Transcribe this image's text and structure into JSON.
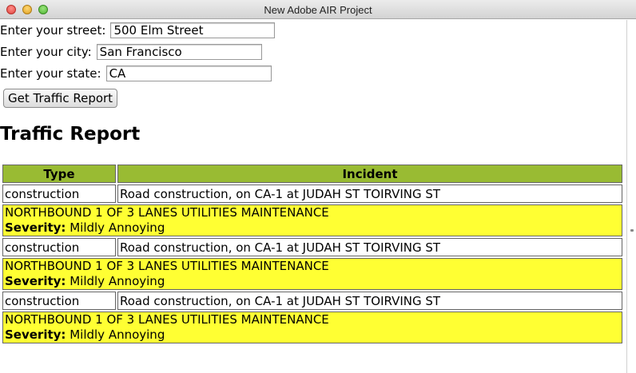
{
  "window": {
    "title": "New Adobe AIR Project"
  },
  "form": {
    "street_label": "Enter your street:",
    "street_value": "500 Elm Street",
    "city_label": "Enter your city:",
    "city_value": "San Francisco",
    "state_label": "Enter your state:",
    "state_value": "CA",
    "submit_label": "Get Traffic Report"
  },
  "report": {
    "heading": "Traffic Report",
    "columns": [
      "Type",
      "Incident"
    ],
    "severity_label": "Severity:",
    "incidents": [
      {
        "type": "construction",
        "incident": "Road construction, on CA-1 at JUDAH ST TOIRVING ST",
        "description": "NORTHBOUND 1 OF 3 LANES UTILITIES MAINTENANCE",
        "severity": "Mildly Annoying"
      },
      {
        "type": "construction",
        "incident": "Road construction, on CA-1 at JUDAH ST TOIRVING ST",
        "description": "NORTHBOUND 1 OF 3 LANES UTILITIES MAINTENANCE",
        "severity": "Mildly Annoying"
      },
      {
        "type": "construction",
        "incident": "Road construction, on CA-1 at JUDAH ST TOIRVING ST",
        "description": "NORTHBOUND 1 OF 3 LANES UTILITIES MAINTENANCE",
        "severity": "Mildly Annoying"
      }
    ]
  },
  "colors": {
    "header_bg": "#99bb33",
    "detail_bg": "#ffff33"
  }
}
